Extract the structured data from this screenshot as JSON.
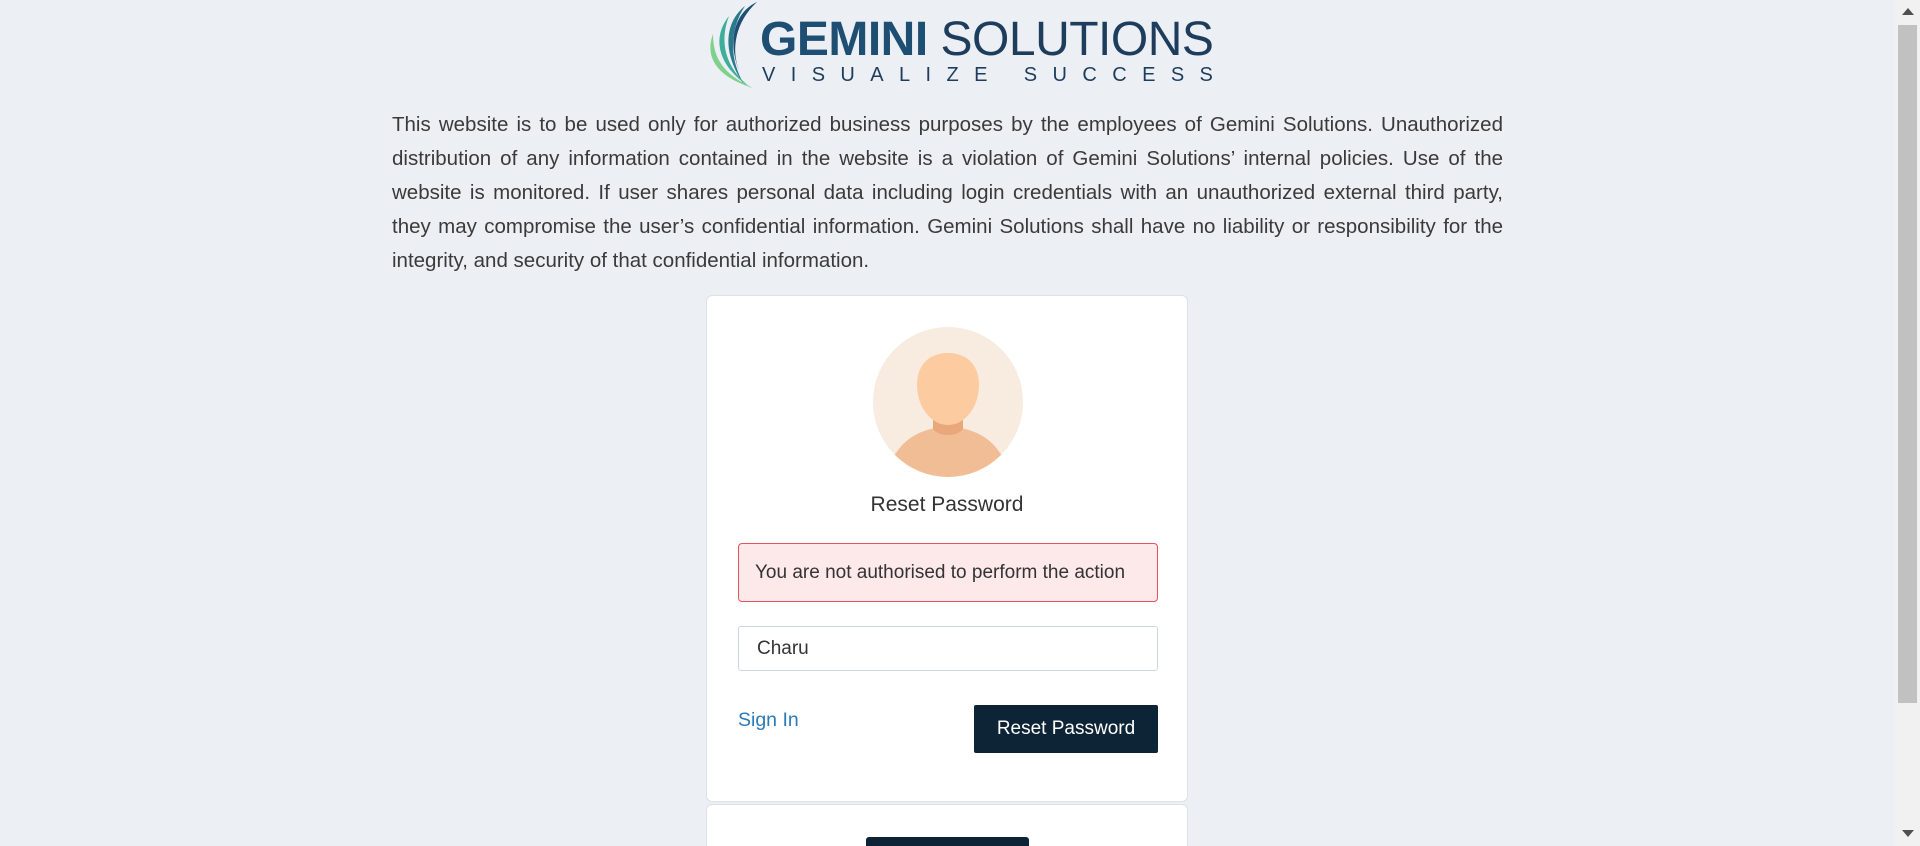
{
  "logo": {
    "brand_bold": "GEMINI",
    "brand_light": "SOLUTIONS",
    "tagline": "VISUALIZE SUCCESS"
  },
  "disclaimer": "This website is to be used only for authorized business purposes by the employees of Gemini Solutions. Unauthorized distribution of any information contained in the website is a violation of Gemini Solutions’ internal policies. Use of the website is monitored. If user shares personal data including login credentials with an unauthorized external third party, they may compromise the user’s confidential information. Gemini Solutions shall have no liability or responsibility for the integrity, and security of that confidential information.",
  "card": {
    "title": "Reset Password",
    "alert": "You are not authorised to perform the action",
    "username_value": "Charu",
    "signin_link": "Sign In",
    "reset_button": "Reset Password"
  },
  "colors": {
    "background": "#eceff3",
    "button": "#0d2436",
    "link": "#2a7ab8",
    "alert_border": "#e4525f",
    "alert_bg": "#fde9ea"
  }
}
